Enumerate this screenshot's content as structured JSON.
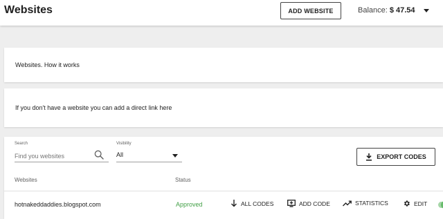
{
  "header": {
    "title": "Websites",
    "add_website_label": "ADD WEBSITE",
    "balance_label": "Balance:",
    "balance_amount": "$ 47.54"
  },
  "info_cards": {
    "how_it_works": "Websites. How it works",
    "direct_link": "If you don't have a website you can add a direct link here"
  },
  "filters": {
    "search_label": "Search",
    "search_placeholder": "Find you websites",
    "search_value": "",
    "visibility_label": "Visibility",
    "visibility_value": "All",
    "export_label": "EXPORT CODES"
  },
  "table": {
    "columns": [
      "Websites",
      "Status"
    ],
    "rows": [
      {
        "website": "hotnakeddaddies.blogspot.com",
        "status": "Approved",
        "status_color": "#43a047",
        "actions": {
          "all_codes": "ALL CODES",
          "add_code": "ADD CODE",
          "statistics": "STATISTICS",
          "edit": "EDIT"
        },
        "enabled": true
      }
    ]
  },
  "icons": {
    "search": "search-icon",
    "download": "download-icon",
    "arrow_down": "arrow-down-icon",
    "add_code": "add-box-icon",
    "trending": "trending-up-icon",
    "gear": "gear-icon",
    "caret": "caret-down-icon"
  },
  "colors": {
    "background": "#eeeeee",
    "card": "#ffffff",
    "approved": "#43a047",
    "toggle_on": "#66bb6a"
  }
}
